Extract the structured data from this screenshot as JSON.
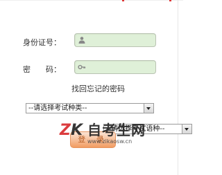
{
  "form": {
    "id_label": "身份证号：",
    "password_label": "密　　码：",
    "id_value": "",
    "password_value": "",
    "forgot_password_link": "找回忘记的密码",
    "exam_type_select": "--请选择考试种类--",
    "exam_language_select": "--请选择考试语种--",
    "login_button": "登  录"
  },
  "watermark": {
    "logo_text_k": "K",
    "logo_text_z": "Z",
    "title": "自考生网",
    "url": "www.zikaosw.cn"
  },
  "colors": {
    "input_bg": "#dff0d8",
    "button_gradient_top": "#fbe4d5",
    "button_gradient_bottom": "#f29c62",
    "watermark_red": "#d8282a"
  },
  "icons": {
    "id_field": "user-icon",
    "password_field": "key-icon",
    "select_arrow": "chevron-down-icon"
  }
}
